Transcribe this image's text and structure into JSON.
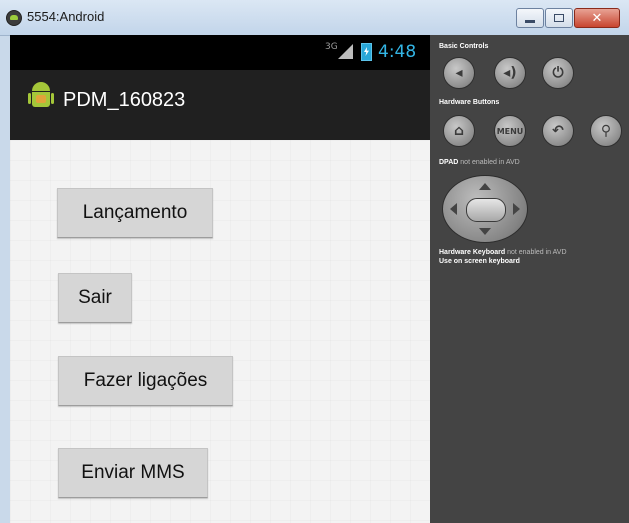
{
  "window": {
    "title": "5554:Android",
    "close_label": "✕"
  },
  "statusbar": {
    "network": "3G",
    "time": "4:48"
  },
  "actionbar": {
    "title": "PDM_160823",
    "icon": "android-icon"
  },
  "buttons": [
    {
      "label": "Lançamento"
    },
    {
      "label": "Sair"
    },
    {
      "label": "Fazer ligações"
    },
    {
      "label": "Enviar MMS"
    }
  ],
  "controls": {
    "basic_label": "Basic Controls",
    "hardware_label": "Hardware Buttons",
    "dpad_label": "DPAD",
    "dpad_note": "not enabled in AVD",
    "keyboard_label": "Hardware Keyboard",
    "keyboard_note": "not enabled in AVD",
    "onscreen_label": "Use on screen keyboard",
    "menu_label": "MENU",
    "basic_buttons": [
      "volume-down-icon",
      "volume-up-icon",
      "power-icon"
    ],
    "hardware_buttons": [
      "home-icon",
      "menu-button",
      "back-icon",
      "search-icon"
    ]
  },
  "colors": {
    "clock": "#33b5e5",
    "actionbar": "#202020",
    "panel": "#444444"
  }
}
